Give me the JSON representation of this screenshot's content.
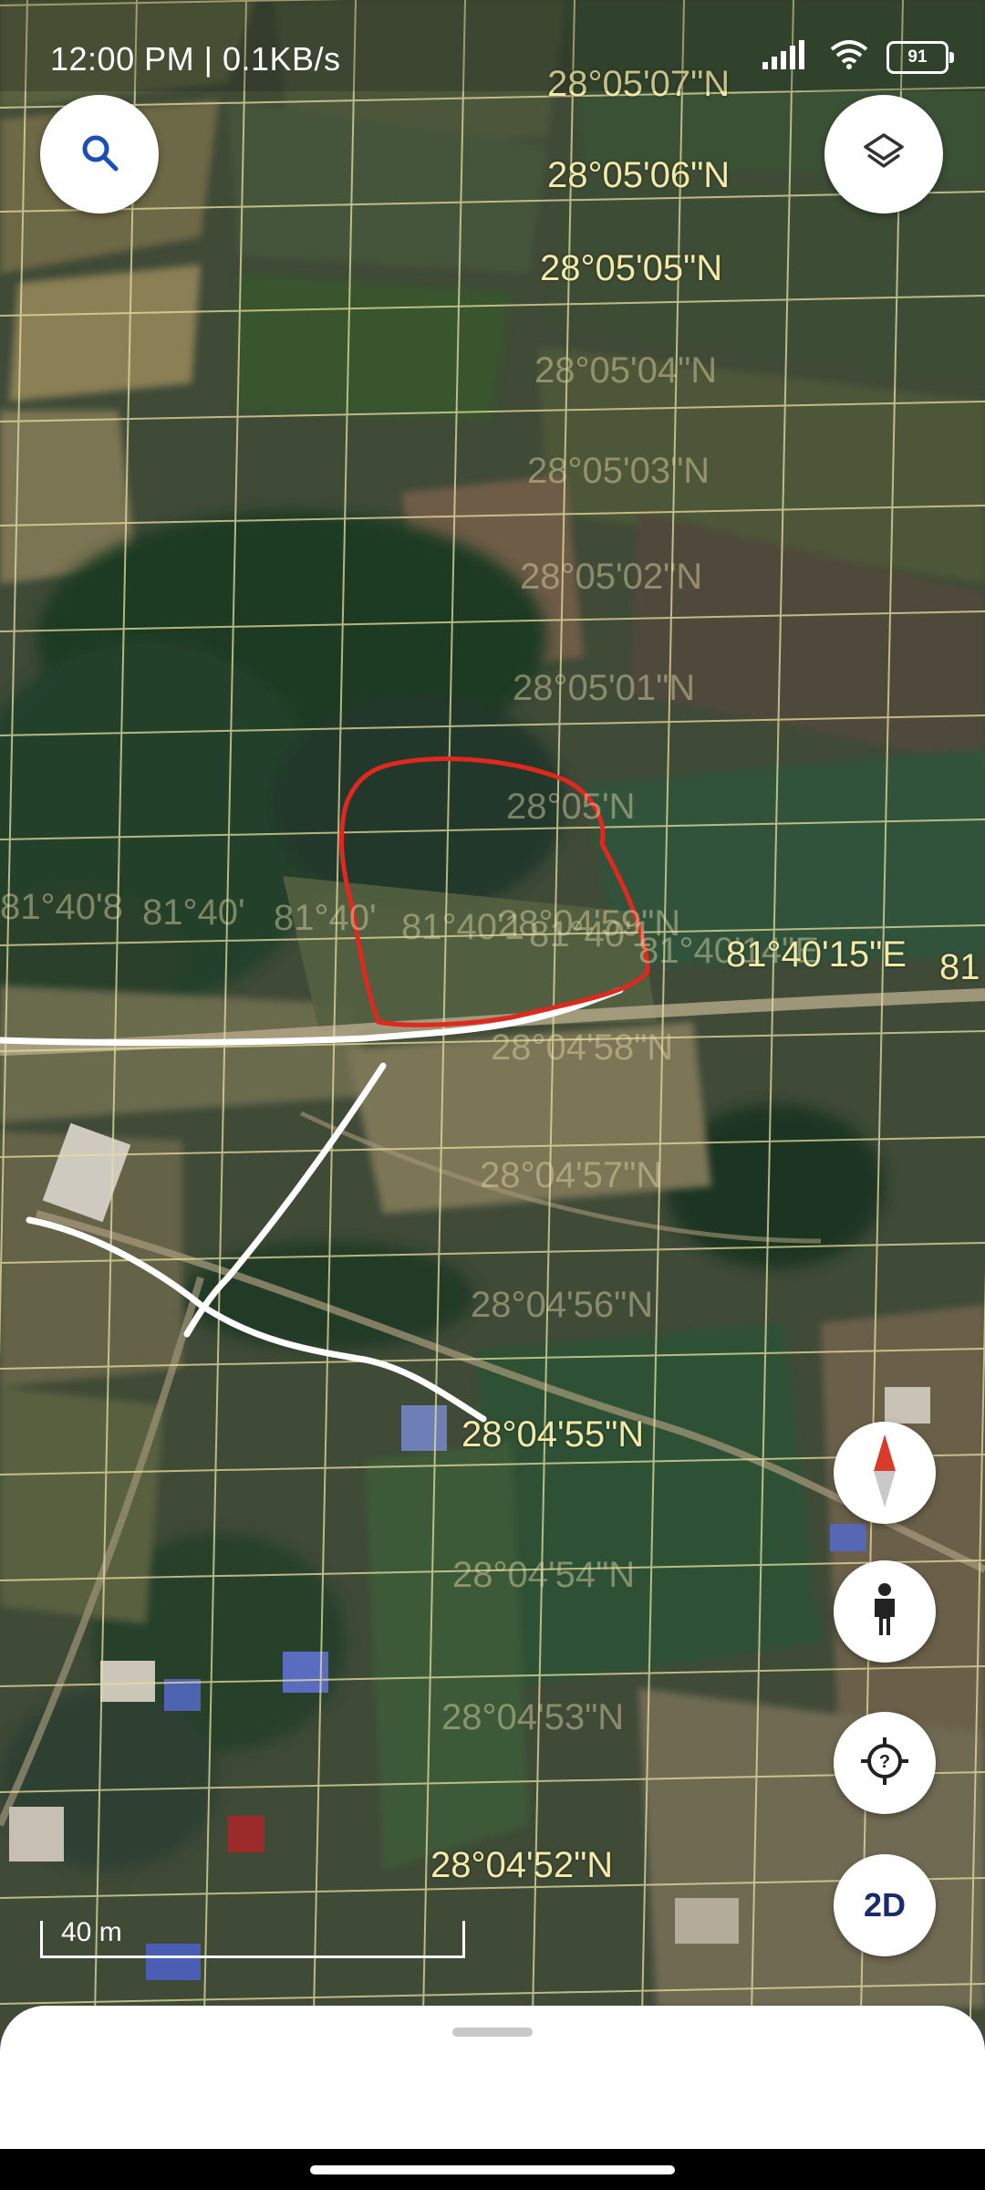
{
  "status_bar": {
    "time_text": "12:00 PM | 0.1KB/s",
    "battery_level": "91"
  },
  "map": {
    "latitude_labels": [
      "28°05'07\"N",
      "28°05'06\"N",
      "28°05'05\"N",
      "28°05'04\"N",
      "28°05'03\"N",
      "28°05'02\"N",
      "28°05'01\"N",
      "28°05'N",
      "28°04'59\"N",
      "28°04'58\"N",
      "28°04'57\"N",
      "28°04'56\"N",
      "28°04'55\"N",
      "28°04'54\"N",
      "28°04'53\"N",
      "28°04'52\"N"
    ],
    "longitude_labels": [
      "81°40'8",
      "81°40'",
      "81°40'",
      "81°40'1",
      "81°40'1",
      "81°40'14\"E",
      "81°40'15\"E",
      "81"
    ],
    "scale_label": "40 m",
    "colors": {
      "grid": "#e8dfa0",
      "user_outline": "#e0281e",
      "user_lines": "#ffffff"
    }
  },
  "controls": {
    "search_icon": "search-icon",
    "layers_icon": "layers-icon",
    "compass_icon": "compass-icon",
    "street_view_icon": "person-icon",
    "my_location_icon": "location-target-icon",
    "view_mode_label": "2D"
  }
}
